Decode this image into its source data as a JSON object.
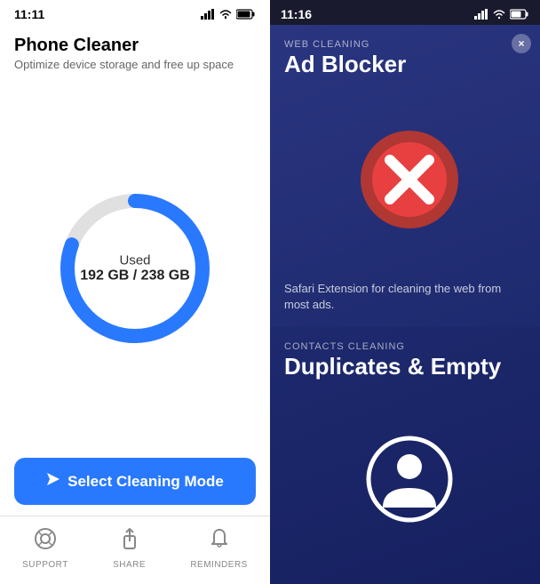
{
  "left_panel": {
    "status_bar": {
      "time": "11:11",
      "signal_icon": "signal",
      "wifi_icon": "wifi",
      "battery_icon": "battery"
    },
    "header": {
      "title": "Phone Cleaner",
      "subtitle": "Optimize device storage and free up space"
    },
    "storage": {
      "used_label": "Used",
      "used_value": "192 GB / 238 GB",
      "used_gb": 192,
      "total_gb": 238
    },
    "select_button": {
      "label": "Select Cleaning Mode",
      "icon": "cursor"
    },
    "nav": [
      {
        "id": "support",
        "label": "SUPPORT",
        "icon": "⊕"
      },
      {
        "id": "share",
        "label": "SHARE",
        "icon": "↑"
      },
      {
        "id": "reminders",
        "label": "REMINDERS",
        "icon": "🔔"
      }
    ]
  },
  "right_panel": {
    "status_bar": {
      "time": "11:16"
    },
    "ad_blocker_card": {
      "category": "WEB CLEANING",
      "title": "Ad Blocker",
      "description": "Safari Extension for cleaning the web from most ads.",
      "close_label": "×"
    },
    "contacts_card": {
      "category": "CONTACTS CLEANING",
      "title": "Duplicates & Empty"
    }
  },
  "colors": {
    "accent_blue": "#2979FF",
    "card_bg_dark": "#1e2a6e",
    "card_bg_medium": "#2a3580",
    "red_circle": "#E84040",
    "dark_red": "#c0392b"
  }
}
